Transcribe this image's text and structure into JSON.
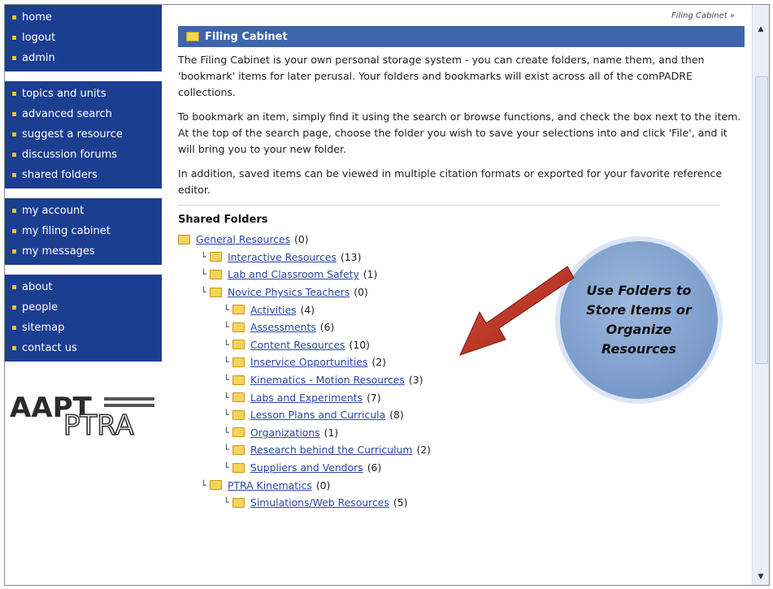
{
  "sidebar": {
    "groups": [
      [
        "home",
        "logout",
        "admin"
      ],
      [
        "topics and units",
        "advanced search",
        "suggest a resource",
        "discussion forums",
        "shared folders"
      ],
      [
        "my account",
        "my filing cabinet",
        "my messages"
      ],
      [
        "about",
        "people",
        "sitemap",
        "contact us"
      ]
    ],
    "logo": "AAPT PTRA"
  },
  "breadcrumb": "Filing Cabinet »",
  "section_title": "Filing Cabinet",
  "paragraphs": [
    "The Filing Cabinet is your own personal storage system - you can create folders, name them, and then 'bookmark' items for later perusal. Your folders and bookmarks will exist across all of the comPADRE collections.",
    "To bookmark an item, simply find it using the search or browse functions, and check the box next to the item. At the top of the search page, choose the folder you wish to save your selections into and click 'File', and it will bring you to your new folder.",
    "In addition, saved items can be viewed in multiple citation formats or exported for your favorite reference editor."
  ],
  "shared_folders_heading": "Shared Folders",
  "folders": [
    {
      "name": "General Resources",
      "count": "(0)",
      "level": 0
    },
    {
      "name": "Interactive Resources",
      "count": "(13)",
      "level": 1
    },
    {
      "name": "Lab and Classroom Safety",
      "count": "(1)",
      "level": 1
    },
    {
      "name": "Novice Physics Teachers",
      "count": "(0)",
      "level": 1
    },
    {
      "name": "Activities",
      "count": "(4)",
      "level": 2
    },
    {
      "name": "Assessments",
      "count": "(6)",
      "level": 2
    },
    {
      "name": "Content Resources",
      "count": "(10)",
      "level": 2
    },
    {
      "name": "Inservice Opportunities",
      "count": "(2)",
      "level": 2
    },
    {
      "name": "Kinematics - Motion Resources",
      "count": "(3)",
      "level": 2
    },
    {
      "name": "Labs and Experiments",
      "count": "(7)",
      "level": 2
    },
    {
      "name": "Lesson Plans and Curricula",
      "count": "(8)",
      "level": 2
    },
    {
      "name": "Organizations",
      "count": "(1)",
      "level": 2
    },
    {
      "name": "Research behind the Curriculum",
      "count": "(2)",
      "level": 2
    },
    {
      "name": "Suppliers and Vendors",
      "count": "(6)",
      "level": 2
    },
    {
      "name": "PTRA Kinematics",
      "count": "(0)",
      "level": 1
    },
    {
      "name": "Simulations/Web Resources",
      "count": "(5)",
      "level": 2
    }
  ],
  "callout_text": "Use Folders to Store Items or Organize Resources",
  "colors": {
    "nav_bg": "#1c3e91",
    "title_bg": "#3e66ad",
    "link": "#2a46a6",
    "bullet": "#f2c12e",
    "arrow": "#c0392b",
    "callout": "#7e9ecd"
  },
  "icons": {
    "folder": "folder-icon",
    "bullet": "bullet-icon",
    "scroll_up": "scroll-up-icon",
    "scroll_down": "scroll-down-icon"
  }
}
